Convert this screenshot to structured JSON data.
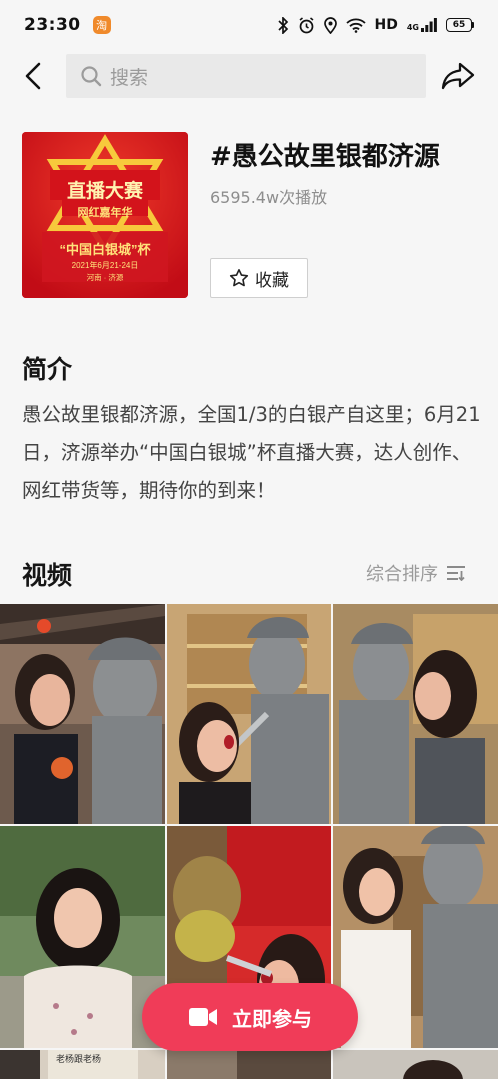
{
  "status_bar": {
    "time": "23:30",
    "app_badge": "淘",
    "network": "HD",
    "signal": "4G",
    "battery": "65"
  },
  "search": {
    "placeholder": "搜索"
  },
  "topic": {
    "title": "#愚公故里银都济源",
    "play_count": "6595.4w次播放",
    "collect_label": "收藏",
    "cover": {
      "line1": "直播大赛",
      "line2": "网红嘉年华",
      "line3": "“中国白银城”杯",
      "date": "2021年6月21-24日",
      "place": "河南 · 济源"
    }
  },
  "intro": {
    "heading": "简介",
    "text": "愚公故里银都济源，全国1/3的白银产自这里；6月21日，济源举办“中国白银城”杯直播大赛，达人创作、网红带货等，期待你的到来！"
  },
  "videos": {
    "heading": "视频",
    "sort_label": "综合排序"
  },
  "join_button": {
    "label": "立即参与"
  },
  "colors": {
    "accent": "#f03c58",
    "cover_red": "#d3131b",
    "cover_gold": "#f7c93c"
  }
}
